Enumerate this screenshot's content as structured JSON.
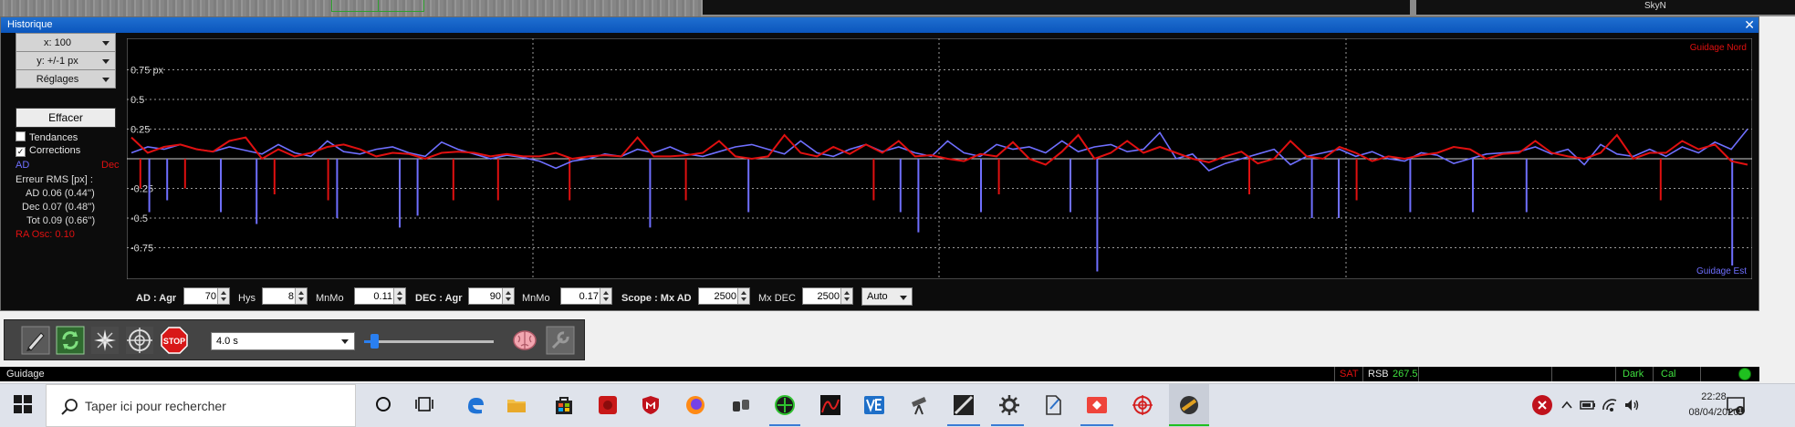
{
  "window": {
    "title": "Historique",
    "close": "✕"
  },
  "left_panel": {
    "x_scale": "x: 100",
    "y_scale": "y: +/-1 px",
    "settings": "Réglages",
    "clear": "Effacer",
    "trends": "Tendances",
    "trends_checked": false,
    "corrections": "Corrections",
    "corrections_checked": true,
    "ra_label": "AD",
    "dec_label": "Dec",
    "rms_title": "Erreur RMS [px] :",
    "rms_ra": "AD  0.06 (0.44'')",
    "rms_dec": "Dec  0.07 (0.48'')",
    "rms_tot": "Tot  0.09 (0.66'')",
    "ra_osc": "RA Osc: 0.10"
  },
  "graph": {
    "label_north": "Guidage Nord",
    "label_east": "Guidage Est",
    "y_labels": [
      "0.75 px",
      "0.5",
      "0.25",
      "-0.25",
      "-0.5",
      "-0.75"
    ],
    "ra_color": "#6f6fff",
    "dec_color": "#e01010",
    "grid_color": "#9a9a9a"
  },
  "chart_data": {
    "type": "line",
    "title": "",
    "xlabel": "",
    "ylabel": "",
    "ylim": [
      -1,
      1
    ],
    "x_count": 100,
    "y_tick_labels": [
      "0.75 px",
      "0.5",
      "0.25",
      "-0.25",
      "-0.5",
      "-0.75"
    ],
    "legend": [
      "AD",
      "Dec"
    ],
    "series": [
      {
        "name": "AD",
        "color": "#6f6fff",
        "values": [
          0.05,
          0.1,
          0.08,
          0.12,
          0.08,
          0.06,
          0.1,
          0.07,
          0.04,
          0.12,
          0.05,
          0.02,
          0.15,
          0.06,
          0.04,
          0.08,
          0.1,
          0.05,
          0.02,
          0.14,
          0.08,
          0.04,
          0.0,
          0.03,
          0.01,
          -0.02,
          -0.08,
          -0.02,
          0.0,
          0.04,
          0.02,
          0.08,
          0.05,
          0.1,
          0.04,
          0.02,
          0.06,
          0.1,
          0.12,
          0.08,
          0.04,
          0.15,
          0.05,
          0.02,
          0.08,
          0.12,
          0.06,
          0.1,
          0.05,
          0.02,
          0.15,
          0.05,
          0.02,
          0.12,
          0.08,
          0.1,
          0.05,
          0.15,
          0.06,
          0.1,
          0.12,
          0.06,
          0.08,
          0.22,
          0.0,
          0.04,
          -0.1,
          -0.04,
          0.0,
          0.04,
          0.08,
          -0.05,
          0.02,
          0.05,
          0.08,
          0.02,
          0.06,
          0.0,
          -0.02,
          0.05,
          0.03,
          -0.04,
          0.0,
          0.04,
          0.05,
          0.06,
          0.1,
          0.04,
          0.08,
          -0.05,
          0.12,
          0.04,
          0.02,
          0.08,
          0.02,
          0.1,
          0.05,
          0.14,
          0.08,
          0.25
        ]
      },
      {
        "name": "Dec",
        "color": "#e01010",
        "values": [
          0.18,
          0.05,
          0.1,
          0.12,
          0.08,
          0.06,
          0.15,
          0.18,
          0.0,
          0.08,
          0.02,
          0.05,
          0.1,
          0.12,
          0.08,
          0.02,
          0.05,
          0.04,
          0.0,
          0.05,
          0.06,
          0.05,
          0.02,
          0.04,
          0.02,
          0.02,
          0.05,
          0.0,
          0.02,
          0.03,
          0.02,
          0.18,
          0.02,
          0.02,
          0.03,
          0.05,
          0.15,
          0.02,
          0.0,
          0.02,
          0.2,
          0.05,
          0.02,
          0.1,
          0.04,
          0.12,
          0.05,
          0.15,
          0.02,
          0.03,
          0.0,
          -0.02,
          0.04,
          0.02,
          0.14,
          0.0,
          -0.05,
          0.06,
          0.2,
          0.0,
          0.05,
          0.15,
          0.05,
          0.1,
          0.05,
          0.0,
          -0.03,
          0.02,
          0.06,
          -0.04,
          0.0,
          0.15,
          0.02,
          0.0,
          0.1,
          0.05,
          -0.02,
          0.02,
          0.0,
          0.03,
          0.05,
          0.1,
          0.08,
          0.0,
          0.04,
          0.05,
          0.15,
          0.05,
          0.02,
          0.0,
          0.05,
          0.2,
          0.0,
          0.05,
          0.05,
          0.15,
          0.08,
          0.12,
          -0.02,
          -0.05
        ]
      }
    ],
    "ra_pulses": [
      {
        "x": 2,
        "v": -0.45
      },
      {
        "x": 4,
        "v": -0.35
      },
      {
        "x": 10,
        "v": -0.45
      },
      {
        "x": 14,
        "v": -0.55
      },
      {
        "x": 23,
        "v": -0.5
      },
      {
        "x": 30,
        "v": -0.58
      },
      {
        "x": 32,
        "v": -0.48
      },
      {
        "x": 58,
        "v": -0.58
      },
      {
        "x": 69,
        "v": -0.45
      },
      {
        "x": 86,
        "v": -0.45
      },
      {
        "x": 88,
        "v": -0.62
      },
      {
        "x": 95,
        "v": -0.45
      },
      {
        "x": 105,
        "v": -0.45
      },
      {
        "x": 108,
        "v": -0.95
      },
      {
        "x": 132,
        "v": -0.5
      },
      {
        "x": 135,
        "v": -0.5
      },
      {
        "x": 143,
        "v": -0.45
      },
      {
        "x": 150,
        "v": -0.45
      },
      {
        "x": 156,
        "v": -0.45
      },
      {
        "x": 179,
        "v": -0.9
      }
    ],
    "dec_pulses": [
      {
        "x": 1,
        "v": -0.25
      },
      {
        "x": 6,
        "v": -0.25
      },
      {
        "x": 16,
        "v": -0.3
      },
      {
        "x": 22,
        "v": -0.35
      },
      {
        "x": 36,
        "v": -0.35
      },
      {
        "x": 41,
        "v": -0.35
      },
      {
        "x": 49,
        "v": -0.35
      },
      {
        "x": 62,
        "v": -0.35
      },
      {
        "x": 83,
        "v": -0.35
      },
      {
        "x": 97,
        "v": -0.3
      },
      {
        "x": 125,
        "v": -0.3
      },
      {
        "x": 137,
        "v": -0.35
      },
      {
        "x": 171,
        "v": -0.35
      }
    ]
  },
  "tuning_bar": {
    "ra_label": "AD : Agr",
    "ra_agr": "70",
    "hys_label": "Hys",
    "hys": "8",
    "mnmo_label": "MnMo",
    "ra_mnmo": "0.11",
    "dec_label": "DEC : Agr",
    "dec_agr": "90",
    "dec_mnmo_label": "MnMo",
    "dec_mnmo": "0.17",
    "scope_label": "Scope : Mx AD",
    "mx_ad": "2500",
    "mx_dec_label": "Mx DEC",
    "mx_dec": "2500",
    "mode": "Auto"
  },
  "guide_toolbar": {
    "exposure": "4.0 s",
    "gain_fraction": 0.08,
    "stop_label": "STOP"
  },
  "status_bar": {
    "left": "Guidage",
    "sat": "SAT",
    "rsb_label": "RSB",
    "rsb_value": "267.5",
    "dark": "Dark",
    "cal": "Cal"
  },
  "taskbar": {
    "search_placeholder": "Taper ici pour rechercher",
    "time": "22:28",
    "date": "08/04/2020",
    "notifications": "1"
  },
  "topstrip": {
    "text": "SkyN"
  }
}
